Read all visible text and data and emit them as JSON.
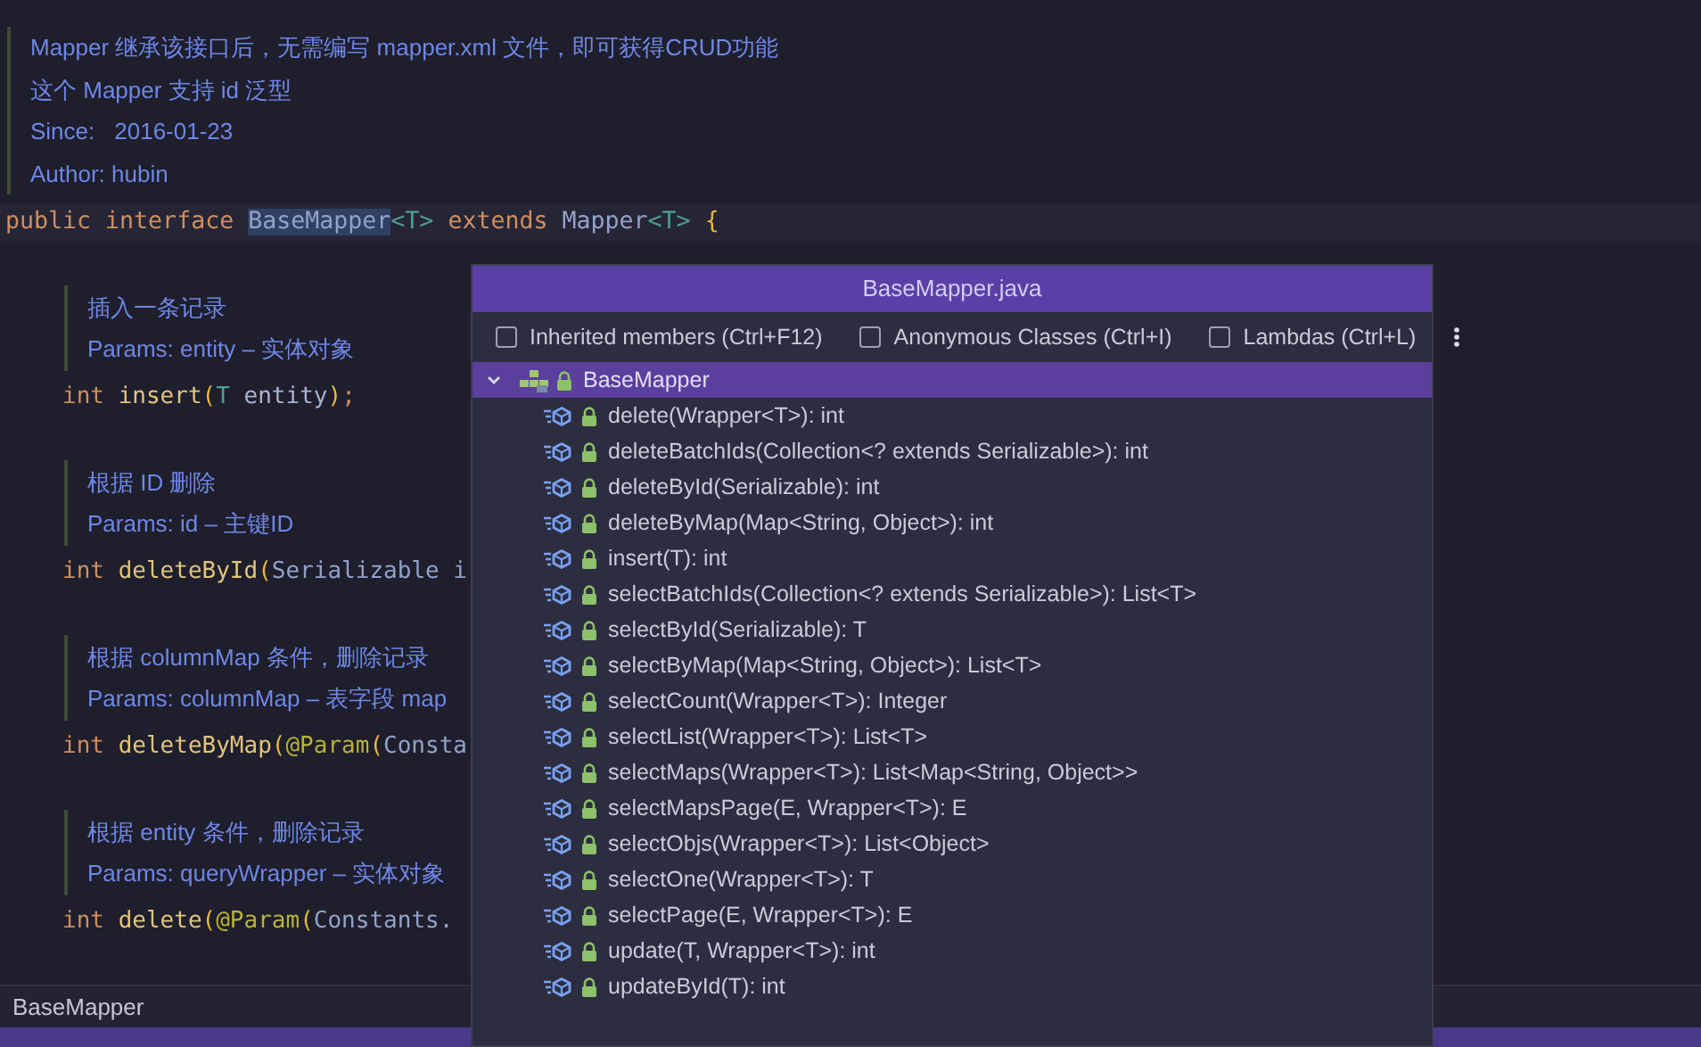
{
  "doc_comment": {
    "description": [
      "Mapper 继承该接口后，无需编写 mapper.xml 文件，即可获得CRUD功能",
      "这个 Mapper 支持 id 泛型"
    ],
    "since": {
      "label": "Since:",
      "value": "2016-01-23"
    },
    "author": "Author: hubin"
  },
  "declaration": [
    {
      "kind": "keyword",
      "text": "public interface ",
      "highlighted": false
    },
    {
      "kind": "type",
      "text": "BaseMapper",
      "highlighted": true
    },
    {
      "kind": "generic",
      "text": "<T>",
      "highlighted": false
    },
    {
      "kind": "keyword",
      "text": " extends ",
      "highlighted": false
    },
    {
      "kind": "type",
      "text": "Mapper",
      "highlighted": false
    },
    {
      "kind": "generic",
      "text": "<T>",
      "highlighted": false
    },
    {
      "kind": "brace",
      "text": " {",
      "highlighted": false
    }
  ],
  "members": [
    {
      "doc": [
        "插入一条记录",
        "Params: entity – 实体对象"
      ],
      "code": [
        {
          "kind": "keyword",
          "text": "int "
        },
        {
          "kind": "method",
          "text": "insert"
        },
        {
          "kind": "brace",
          "text": "("
        },
        {
          "kind": "generic",
          "text": "T "
        },
        {
          "kind": "plain",
          "text": "entity"
        },
        {
          "kind": "brace",
          "text": ")"
        },
        {
          "kind": "keyword",
          "text": ";"
        }
      ]
    },
    {
      "doc": [
        "根据 ID 删除",
        "Params: id – 主键ID"
      ],
      "code": [
        {
          "kind": "keyword",
          "text": "int "
        },
        {
          "kind": "method",
          "text": "deleteById"
        },
        {
          "kind": "brace",
          "text": "("
        },
        {
          "kind": "type",
          "text": "Serializable i"
        }
      ]
    },
    {
      "doc": [
        "根据 columnMap 条件，删除记录",
        "Params: columnMap – 表字段 map"
      ],
      "code": [
        {
          "kind": "keyword",
          "text": "int "
        },
        {
          "kind": "method",
          "text": "deleteByMap"
        },
        {
          "kind": "brace",
          "text": "("
        },
        {
          "kind": "annotation",
          "text": "@Param"
        },
        {
          "kind": "brace",
          "text": "("
        },
        {
          "kind": "type",
          "text": "Consta"
        }
      ]
    },
    {
      "doc": [
        "根据 entity 条件，删除记录",
        "Params: queryWrapper – 实体对象"
      ],
      "code": [
        {
          "kind": "keyword",
          "text": "int "
        },
        {
          "kind": "method",
          "text": "delete"
        },
        {
          "kind": "brace",
          "text": "("
        },
        {
          "kind": "annotation",
          "text": "@Param"
        },
        {
          "kind": "brace",
          "text": "("
        },
        {
          "kind": "type",
          "text": "Constants."
        }
      ]
    }
  ],
  "breadcrumb": "BaseMapper",
  "structure_popup": {
    "title": "BaseMapper.java",
    "options": [
      {
        "label": "Inherited members (Ctrl+F12)",
        "checked": false
      },
      {
        "label": "Anonymous Classes (Ctrl+I)",
        "checked": false
      },
      {
        "label": "Lambdas (Ctrl+L)",
        "checked": false
      }
    ],
    "root": {
      "label": "BaseMapper",
      "expanded": true,
      "selected": true,
      "children": [
        {
          "label": "delete(Wrapper<T>): int"
        },
        {
          "label": "deleteBatchIds(Collection<? extends Serializable>): int"
        },
        {
          "label": "deleteById(Serializable): int"
        },
        {
          "label": "deleteByMap(Map<String, Object>): int"
        },
        {
          "label": "insert(T): int"
        },
        {
          "label": "selectBatchIds(Collection<? extends Serializable>): List<T>"
        },
        {
          "label": "selectById(Serializable): T"
        },
        {
          "label": "selectByMap(Map<String, Object>): List<T>"
        },
        {
          "label": "selectCount(Wrapper<T>): Integer"
        },
        {
          "label": "selectList(Wrapper<T>): List<T>"
        },
        {
          "label": "selectMaps(Wrapper<T>): List<Map<String, Object>>"
        },
        {
          "label": "selectMapsPage(E, Wrapper<T>): E"
        },
        {
          "label": "selectObjs(Wrapper<T>): List<Object>"
        },
        {
          "label": "selectOne(Wrapper<T>): T"
        },
        {
          "label": "selectPage(E, Wrapper<T>): E"
        },
        {
          "label": "update(T, Wrapper<T>): int"
        },
        {
          "label": "updateById(T): int"
        }
      ]
    }
  }
}
